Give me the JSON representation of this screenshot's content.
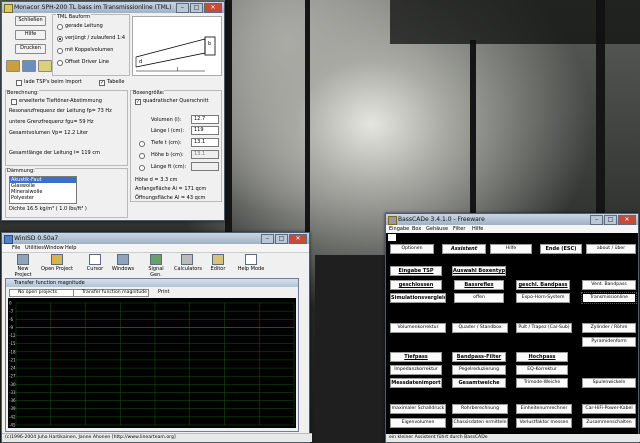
{
  "monacor": {
    "title": "Monacor SPH-200 TL bass im Transmissionline (TML)",
    "buttons": {
      "close": "Schließen",
      "help": "Hilfe",
      "print": "Drucken"
    },
    "tml_group": "TML Bauform",
    "tml_options": [
      "gerade Leitung",
      "verjüngt / zulaufend 1:4",
      "mit Koppelvolumen",
      "Offset Driver Line"
    ],
    "tml_selected": 1,
    "diagram_labels": {
      "d": "d",
      "l": "l",
      "b": "b"
    },
    "check_tsp": "lade TSP's beim Import",
    "check_table": "Tabelle",
    "calc_group": "Berechnung:",
    "calc_check": "erweiterte Tieftöner-Abstimmung",
    "calc_lines": [
      "Resonanzfrequenz der Leitung fp= 73 Hz",
      "untere Grenzfrequenz fgu= 59 Hz",
      "Gesamtvolumen Vp= 12.2 Liter",
      "Gesamtlänge der Leitung l= 119 cm"
    ],
    "box_group": "Boxengröße:",
    "box_check": "quadratischer Querschnitt",
    "box_fields": [
      {
        "label": "Volumen (l):",
        "value": "12.7"
      },
      {
        "label": "Länge l (cm):",
        "value": "119"
      },
      {
        "label": "Tiefe t (cm):",
        "value": "13.1"
      },
      {
        "label": "Höhe b (cm):",
        "value": "13.1"
      },
      {
        "label": "Länge ft (cm):",
        "value": ""
      }
    ],
    "box_results": [
      "Höhe d = 3.3 cm",
      "Anfangsfläche Ai = 171 qcm",
      "Öffnungsfläche Al = 43 qcm"
    ],
    "damping_group": "Dämmung:",
    "damping_items": [
      "Akustik-Faut",
      "Glaswolle",
      "Mineralwolle",
      "Polyester"
    ],
    "damping_selected": 0,
    "damping_result": "Dichte 16.5 kg/m³ ( 1.0 lbs/ft³ )"
  },
  "winisd": {
    "title": "WinISD 0.50a7",
    "menu": [
      "File",
      "Utilities",
      "Window",
      "Help"
    ],
    "toolbar": [
      "New Project",
      "Open Project",
      "Cursor",
      "Windows",
      "Signal Gen.",
      "Calculators",
      "Editor",
      "Help Mode"
    ],
    "subwindow_title": "Transfer function magnitude",
    "projects_select": "No open projects",
    "graph_select": "Transfer function magnitude",
    "print_label": "Print",
    "y_ticks": [
      "0",
      "-3",
      "-6",
      "-9",
      "-12",
      "-15",
      "-18",
      "-21",
      "-24",
      "-27",
      "-30",
      "-33",
      "-36",
      "-39",
      "-42",
      "-45"
    ],
    "status": "(c)1996-2004 Juha Hartikainen, Janne Ahonen [http://www.linearteam.org]"
  },
  "basscade": {
    "title": "BassCADe 3.4.1.0 - Freeware",
    "menu": [
      "Eingabe",
      "Box",
      "Gehäuse",
      "Filter",
      "Hilfe"
    ],
    "buttons": {
      "options": "Optionen",
      "assistant": "Assistent",
      "help": "Hilfe",
      "end": "Ende (ESC)",
      "about": "about / über",
      "input_tsp": "Eingabe TSP",
      "select_box": "Auswahl Boxentyp",
      "closed": "geschlossen",
      "bassreflex": "Bassreflex",
      "closed_bandpass": "geschl. Bandpass",
      "vent_bandpass": "Vent. Bandpass",
      "simulation": "Simulationsvergleich",
      "open": "offen",
      "expo_horn": "Expo-Horn-System",
      "transmissionline": "Transmissionline",
      "volume_correction": "Volumenkorrektur",
      "quader": "Quader / Standbox",
      "desk": "Pult / Trapez (Car-Sub)",
      "cylinder": "Zylinder / Röhre",
      "pyramid": "Pyramidenform",
      "lowpass": "Tiefpass",
      "bandpass_filter": "Bandpass-Filter",
      "highpass": "Hochpass",
      "impedance": "Impedanzkorrektur",
      "level": "Pegelreduzierung",
      "eq": "EQ-Korrektur",
      "measure_import": "Messdatenimport",
      "total": "Gesamtweiche",
      "trimode": "Trimode-Weiche",
      "coil": "Spulenwickeln",
      "max_spl": "maximaler Schalldruck",
      "pipe": "Rohrberechnung",
      "unit_converter": "Einheitenumrechner",
      "car_hifi": "Car-HiFi-Power-Kabel",
      "eigenvolume": "Eigenvolumen",
      "chassis": "Chassisdaten ermitteln",
      "loss": "Verlustfaktor messen",
      "connection": "Zusammenschalten"
    },
    "status": "ein kleiner Assistent führt durch BassCADe"
  }
}
